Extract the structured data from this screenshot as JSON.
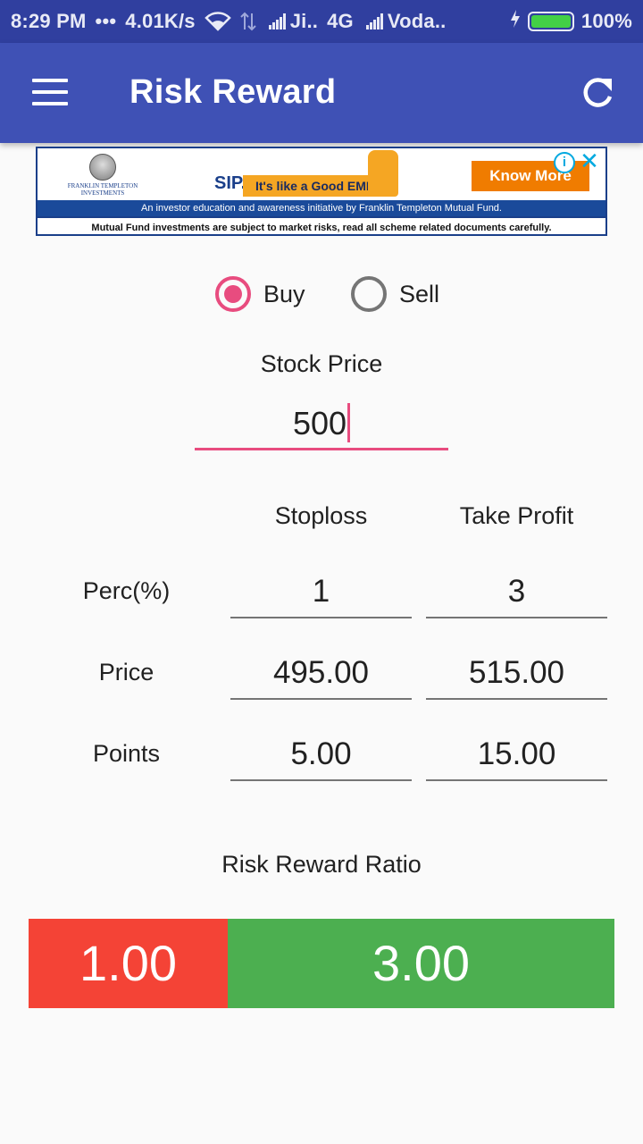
{
  "status_bar": {
    "time": "8:29 PM",
    "dots": "•••",
    "speed": "4.01K/s",
    "carrier1": "Ji..",
    "network": "4G",
    "carrier2": "Voda..",
    "battery": "100%",
    "battery_level": 1.0,
    "icons": [
      "wifi-icon",
      "data-arrows-icon",
      "signal-icon",
      "signal-icon",
      "charging-icon",
      "battery-icon"
    ]
  },
  "app_bar": {
    "title": "Risk Reward",
    "menu_icon": "hamburger-menu-icon",
    "refresh_icon": "refresh-icon",
    "color": "#3f51b5"
  },
  "ad": {
    "logo_text": "FRANKLIN TEMPLETON INVESTMENTS",
    "sip": "SIP.",
    "tagline": "It's like a Good EMI.",
    "cta": "Know More",
    "line1": "An investor education and awareness initiative by Franklin Templeton Mutual Fund.",
    "line2": "Mutual Fund investments are subject to market risks, read all scheme related documents carefully."
  },
  "radio": {
    "options": [
      {
        "label": "Buy",
        "checked": true
      },
      {
        "label": "Sell",
        "checked": false
      }
    ],
    "accent": "#e84c7f"
  },
  "stock": {
    "label": "Stock Price",
    "value": "500"
  },
  "grid": {
    "headers": [
      "Stoploss",
      "Take Profit"
    ],
    "rows": [
      {
        "label": "Perc(%)",
        "stoploss": "1",
        "take_profit": "3"
      },
      {
        "label": "Price",
        "stoploss": "495.00",
        "take_profit": "515.00"
      },
      {
        "label": "Points",
        "stoploss": "5.00",
        "take_profit": "15.00"
      }
    ]
  },
  "ratio": {
    "label": "Risk Reward Ratio",
    "risk": "1.00",
    "reward": "3.00",
    "risk_color": "#f44336",
    "reward_color": "#4caf50"
  }
}
